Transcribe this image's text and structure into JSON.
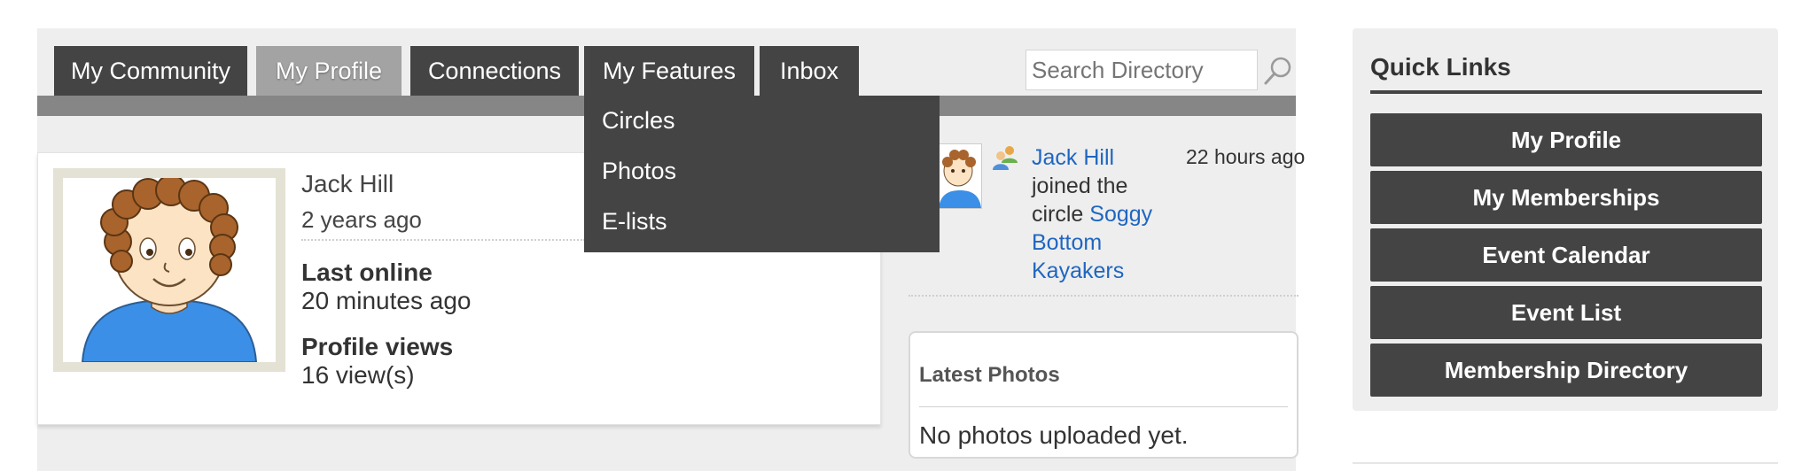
{
  "nav": {
    "tabs": [
      {
        "label": "My Community"
      },
      {
        "label": "My Profile"
      },
      {
        "label": "Connections"
      },
      {
        "label": "My Features"
      },
      {
        "label": "Inbox"
      }
    ],
    "active_tab": "My Profile",
    "search_placeholder": "Search Directory"
  },
  "dropdown": {
    "items": [
      {
        "label": "Circles"
      },
      {
        "label": "Photos"
      },
      {
        "label": "E-lists"
      }
    ]
  },
  "profile": {
    "name": "Jack Hill",
    "member_since": "2 years ago",
    "last_online_label": "Last online",
    "last_online_value": "20 minutes ago",
    "profile_views_label": "Profile views",
    "profile_views_value": "16 view(s)"
  },
  "activity": {
    "user_link": "Jack Hill",
    "text_1": "joined the circle",
    "circle_link": "Soggy Bottom Kayakers",
    "time": "22 hours ago"
  },
  "latest_photos": {
    "title": "Latest Photos",
    "empty_text": "No photos uploaded yet."
  },
  "quick_links": {
    "title": "Quick Links",
    "buttons": [
      {
        "label": "My Profile"
      },
      {
        "label": "My Memberships"
      },
      {
        "label": "Event Calendar"
      },
      {
        "label": "Event List"
      },
      {
        "label": "Membership Directory"
      }
    ]
  },
  "colors": {
    "tab_bg": "#444444",
    "tab_active_bg": "#a3a3a3",
    "link": "#1f66c1",
    "panel_bg": "#eeeeee"
  }
}
